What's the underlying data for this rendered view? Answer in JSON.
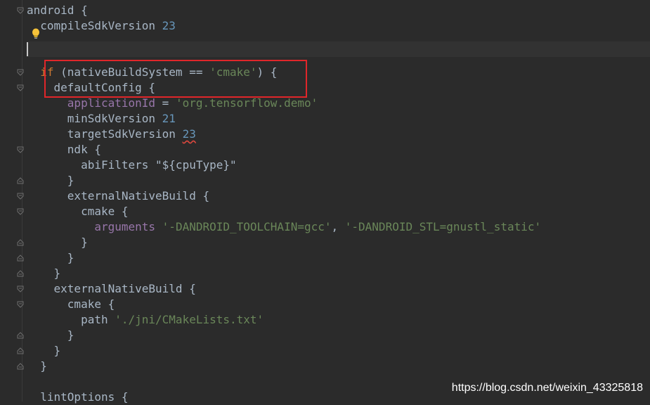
{
  "editor": {
    "lines": [
      [
        {
          "t": "android {",
          "c": "plain"
        }
      ],
      [
        {
          "t": "  compileSdkVersion ",
          "c": "plain"
        },
        {
          "t": "23",
          "c": "num"
        }
      ],
      [
        {
          "t": "",
          "c": "plain"
        }
      ],
      [
        {
          "t": "",
          "c": "plain"
        }
      ],
      [
        {
          "t": "  ",
          "c": "plain"
        },
        {
          "t": "if",
          "c": "kw"
        },
        {
          "t": " (nativeBuildSystem == ",
          "c": "plain"
        },
        {
          "t": "'cmake'",
          "c": "str"
        },
        {
          "t": ") {",
          "c": "plain"
        }
      ],
      [
        {
          "t": "    defaultConfig {",
          "c": "plain"
        }
      ],
      [
        {
          "t": "      ",
          "c": "plain"
        },
        {
          "t": "applicationId",
          "c": "prop"
        },
        {
          "t": " = ",
          "c": "plain"
        },
        {
          "t": "'org.tensorflow.demo'",
          "c": "str"
        }
      ],
      [
        {
          "t": "      minSdkVersion ",
          "c": "plain"
        },
        {
          "t": "21",
          "c": "num"
        }
      ],
      [
        {
          "t": "      targetSdkVersion ",
          "c": "plain"
        },
        {
          "t": "23",
          "c": "num squiggle"
        }
      ],
      [
        {
          "t": "      ndk {",
          "c": "plain"
        }
      ],
      [
        {
          "t": "        abiFilters ",
          "c": "plain"
        },
        {
          "t": "\"${cpuType}\"",
          "c": "plain"
        }
      ],
      [
        {
          "t": "      }",
          "c": "plain"
        }
      ],
      [
        {
          "t": "      externalNativeBuild {",
          "c": "plain"
        }
      ],
      [
        {
          "t": "        cmake {",
          "c": "plain"
        }
      ],
      [
        {
          "t": "          ",
          "c": "plain"
        },
        {
          "t": "arguments",
          "c": "prop"
        },
        {
          "t": " ",
          "c": "plain"
        },
        {
          "t": "'-DANDROID_TOOLCHAIN=gcc'",
          "c": "str"
        },
        {
          "t": ", ",
          "c": "plain"
        },
        {
          "t": "'-DANDROID_STL=gnustl_static'",
          "c": "str"
        }
      ],
      [
        {
          "t": "        }",
          "c": "plain"
        }
      ],
      [
        {
          "t": "      }",
          "c": "plain"
        }
      ],
      [
        {
          "t": "    }",
          "c": "plain"
        }
      ],
      [
        {
          "t": "    externalNativeBuild {",
          "c": "plain"
        }
      ],
      [
        {
          "t": "      cmake {",
          "c": "plain"
        }
      ],
      [
        {
          "t": "        path ",
          "c": "plain"
        },
        {
          "t": "'./jni/CMakeLists.txt'",
          "c": "str"
        }
      ],
      [
        {
          "t": "      }",
          "c": "plain"
        }
      ],
      [
        {
          "t": "    }",
          "c": "plain"
        }
      ],
      [
        {
          "t": "  }",
          "c": "plain"
        }
      ],
      [
        {
          "t": "",
          "c": "plain"
        }
      ],
      [
        {
          "t": "  lintOptions {",
          "c": "plain"
        }
      ]
    ],
    "fold_markers": [
      {
        "line": 0,
        "kind": "open"
      },
      {
        "line": 4,
        "kind": "open"
      },
      {
        "line": 5,
        "kind": "open"
      },
      {
        "line": 9,
        "kind": "open"
      },
      {
        "line": 11,
        "kind": "close"
      },
      {
        "line": 12,
        "kind": "open"
      },
      {
        "line": 13,
        "kind": "open"
      },
      {
        "line": 15,
        "kind": "close"
      },
      {
        "line": 16,
        "kind": "close"
      },
      {
        "line": 17,
        "kind": "close"
      },
      {
        "line": 18,
        "kind": "open"
      },
      {
        "line": 19,
        "kind": "open"
      },
      {
        "line": 21,
        "kind": "close"
      },
      {
        "line": 22,
        "kind": "close"
      },
      {
        "line": 23,
        "kind": "close"
      }
    ]
  },
  "watermark": "https://blog.csdn.net/weixin_43325818",
  "colors": {
    "background": "#2b2b2b",
    "keyword": "#cc7832",
    "string": "#6a8759",
    "number": "#6897bb",
    "property": "#9876aa",
    "text": "#a9b7c6",
    "highlight_box": "#e0262a"
  }
}
